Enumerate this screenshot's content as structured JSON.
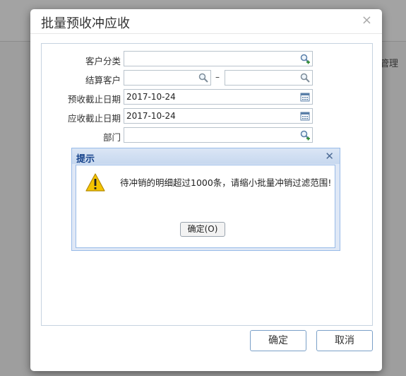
{
  "background": {
    "right_label": "管理"
  },
  "dialog": {
    "title": "批量预收冲应收",
    "close_glyph": "×",
    "form": {
      "customer_category": {
        "label": "客户分类",
        "value": ""
      },
      "settlement_customer": {
        "label": "结算客户",
        "from_value": "",
        "separator": "–",
        "to_value": ""
      },
      "advance_cutoff_date": {
        "label": "预收截止日期",
        "value": "2017-10-24"
      },
      "receivable_cutoff_date": {
        "label": "应收截止日期",
        "value": "2017-10-24"
      },
      "department": {
        "label": "部门",
        "value": ""
      }
    },
    "confirm_label": "确定",
    "cancel_label": "取消"
  },
  "message_box": {
    "title": "提示",
    "close_glyph": "✕",
    "icon": "warning-icon",
    "text": "待冲销的明细超过1000条，请缩小批量冲销过滤范围!",
    "ok_label": "确定(O)"
  },
  "colors": {
    "accent_border": "#7aa0c8",
    "msg_header_text": "#15428b",
    "warning_yellow": "#f5c400"
  }
}
